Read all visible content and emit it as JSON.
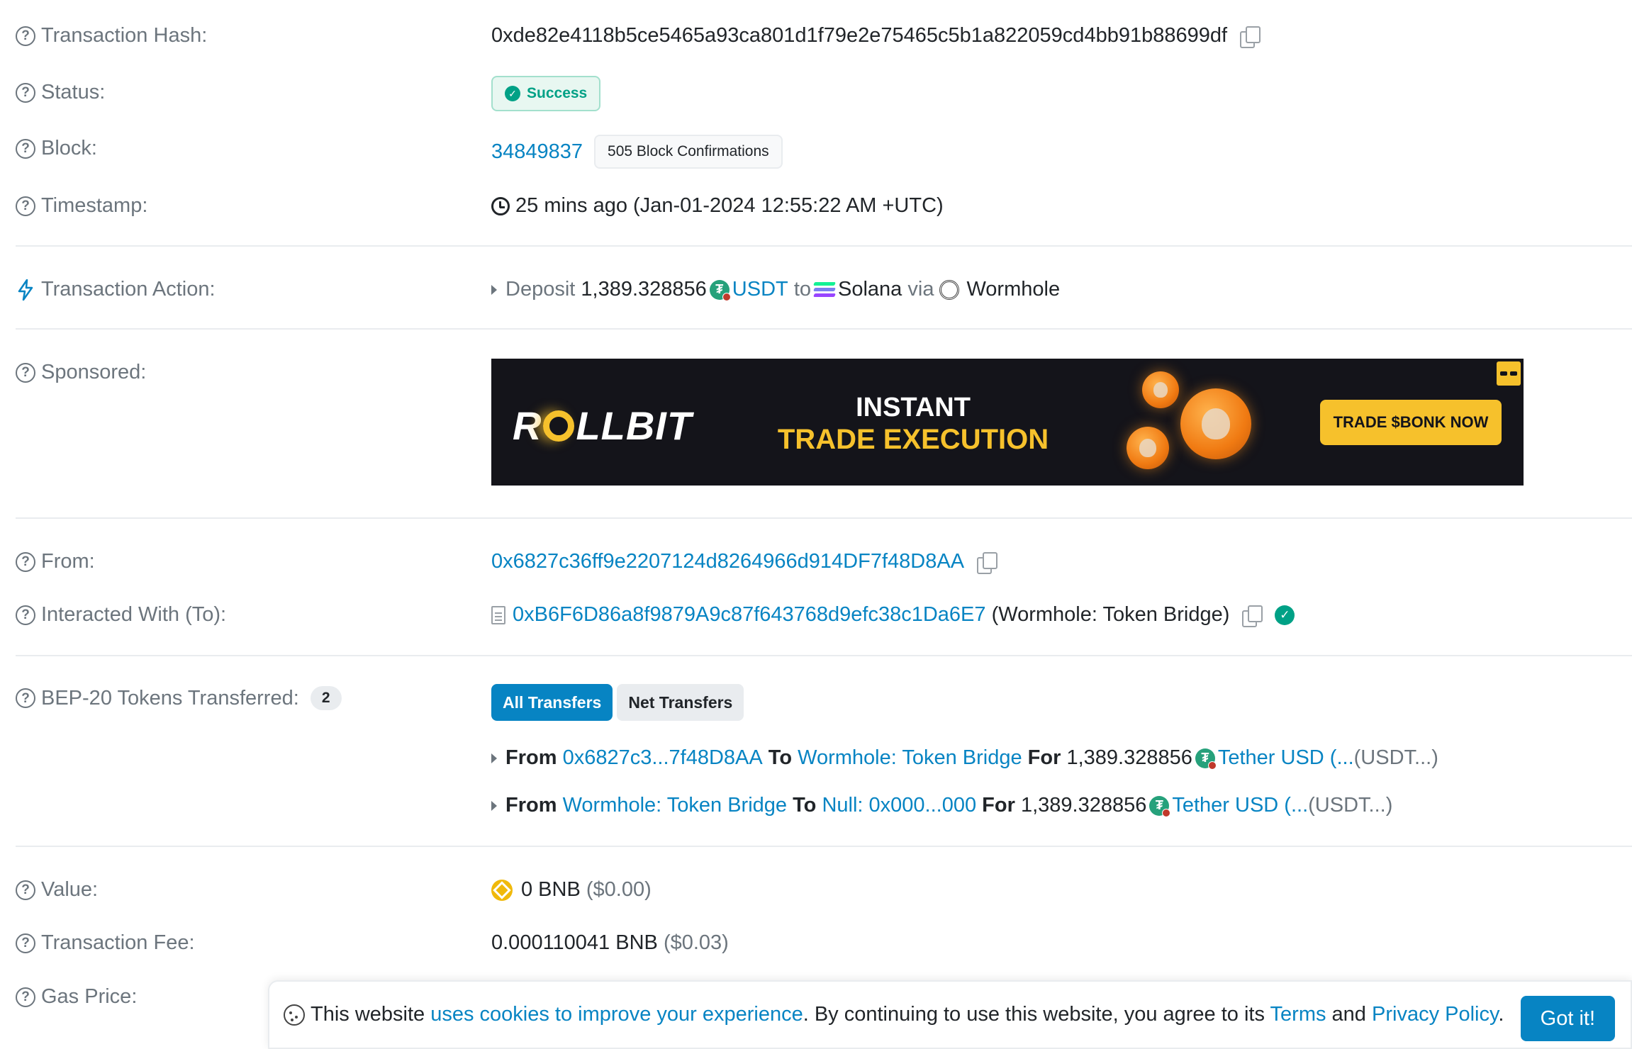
{
  "tx_hash": {
    "label": "Transaction Hash:",
    "value": "0xde82e4118b5ce5465a93ca801d1f79e2e75465c5b1a822059cd4bb91b88699df"
  },
  "status": {
    "label": "Status:",
    "value": "Success"
  },
  "block": {
    "label": "Block:",
    "number": "34849837",
    "confirmations": "505 Block Confirmations"
  },
  "timestamp": {
    "label": "Timestamp:",
    "value": "25 mins ago (Jan-01-2024 12:55:22 AM +UTC)"
  },
  "action": {
    "label": "Transaction Action:",
    "verb": "Deposit",
    "amount": "1,389.328856",
    "token": "USDT",
    "to_word": "to",
    "chain": "Solana",
    "via_word": "via",
    "bridge": "Wormhole"
  },
  "sponsored": {
    "label": "Sponsored:",
    "brand_pre": "R",
    "brand_post": "LLBIT",
    "headline1": "INSTANT",
    "headline2": "TRADE EXECUTION",
    "cta": "TRADE $BONK NOW"
  },
  "from": {
    "label": "From:",
    "address": "0x6827c36ff9e2207124d8264966d914DF7f48D8AA"
  },
  "interacted": {
    "label": "Interacted With (To):",
    "address": "0xB6F6D86a8f9879A9c87f643768d9efc38c1Da6E7",
    "name": "(Wormhole: Token Bridge)"
  },
  "tokens": {
    "label": "BEP-20 Tokens Transferred:",
    "count": "2",
    "tab_all": "All Transfers",
    "tab_net": "Net Transfers",
    "transfers": [
      {
        "from_word": "From",
        "from": "0x6827c3...7f48D8AA",
        "to_word": "To",
        "to": "Wormhole: Token Bridge",
        "for_word": "For",
        "amount": "1,389.328856",
        "token": "Tether USD (...",
        "symbol": "(USDT...)"
      },
      {
        "from_word": "From",
        "from": "Wormhole: Token Bridge",
        "to_word": "To",
        "to": "Null: 0x000...000",
        "for_word": "For",
        "amount": "1,389.328856",
        "token": "Tether USD (...",
        "symbol": "(USDT...)"
      }
    ]
  },
  "value": {
    "label": "Value:",
    "amount": "0 BNB",
    "usd": "($0.00)"
  },
  "fee": {
    "label": "Transaction Fee:",
    "amount": "0.000110041 BNB",
    "usd": "($0.03)"
  },
  "gas": {
    "label": "Gas Price:"
  },
  "cookie": {
    "text1": "This website",
    "link1": "uses cookies to improve your experience",
    "text2": ". By continuing to use this website, you agree to its",
    "terms": "Terms",
    "and": "and",
    "privacy": "Privacy Policy",
    "period": ".",
    "button": "Got it!"
  },
  "icons": [
    "question-icon",
    "copy-icon",
    "check-circle-icon",
    "clock-icon",
    "bolt-icon",
    "caret-right-icon",
    "usdt-token-icon",
    "solana-icon",
    "wormhole-icon",
    "document-icon",
    "verified-icon",
    "bnb-icon",
    "cookie-icon"
  ],
  "colors": {
    "link": "#0784c3",
    "success": "#00a186",
    "muted": "#6c757d",
    "bnb": "#f0b90b",
    "ad_yellow": "#f6c12c"
  }
}
